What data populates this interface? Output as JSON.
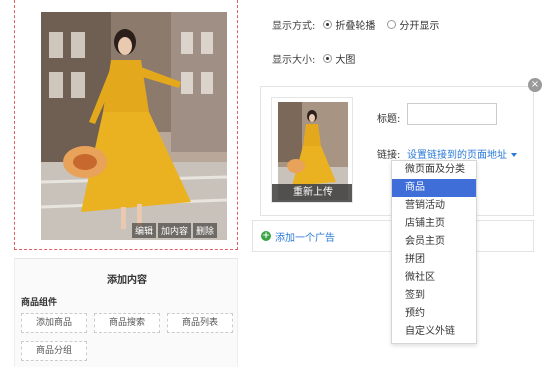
{
  "preview": {
    "actions": [
      "编辑",
      "加内容",
      "删除"
    ]
  },
  "add_content": {
    "title": "添加内容",
    "group_title": "商品组件",
    "components": [
      "添加商品",
      "商品搜索",
      "商品列表",
      "商品分组"
    ]
  },
  "settings": {
    "display_mode_label": "显示方式:",
    "display_mode_options": [
      "折叠轮播",
      "分开显示"
    ],
    "display_mode_selected": "折叠轮播",
    "display_size_label": "显示大小:",
    "display_size_options": [
      "大图"
    ],
    "display_size_selected": "大图"
  },
  "ad_card": {
    "close_icon": "×",
    "reupload_label": "重新上传",
    "title_label": "标题:",
    "title_value": "",
    "link_label": "链接:",
    "link_trigger": "设置链接到的页面地址"
  },
  "add_ad": {
    "icon": "+",
    "label": "添加一个广告"
  },
  "link_menu": {
    "items": [
      "微页面及分类",
      "商品",
      "营销活动",
      "店铺主页",
      "会员主页",
      "拼团",
      "微社区",
      "签到",
      "预约",
      "自定义外链"
    ],
    "active": "商品"
  },
  "colors": {
    "accent_blue": "#2b7ad6",
    "menu_active": "#3f6ed8",
    "add_green": "#3ba547",
    "preview_border": "#e06060"
  }
}
